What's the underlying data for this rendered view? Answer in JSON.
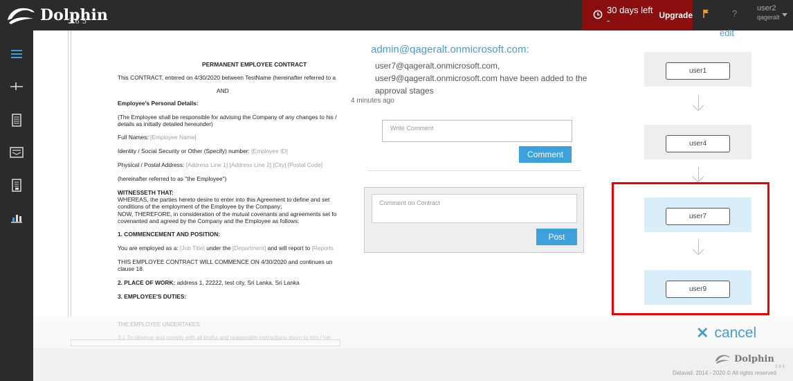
{
  "header": {
    "brand": "Dolphin",
    "brand_sub": "365",
    "trial_text": "30 days left -",
    "upgrade_label": "Upgrade",
    "help_label": "?",
    "user_name": "user2",
    "user_org": "qageralt"
  },
  "sidebar": {
    "items": [
      {
        "icon": "menu-icon"
      },
      {
        "icon": "signature-icon"
      },
      {
        "icon": "documents-icon"
      },
      {
        "icon": "inbox-icon"
      },
      {
        "icon": "contract-icon"
      },
      {
        "icon": "reports-icon"
      }
    ]
  },
  "document": {
    "title": "PERMANENT EMPLOYEE CONTRACT",
    "line1": "This CONTRACT, entered on 4/30/2020 between TestName (hereinafter referred to a",
    "and": "AND",
    "personal_heading": "Employee's Personal Details:",
    "personal_text1": "(The Employee shall be responsible for advising the Company of any changes to his /",
    "personal_text2": "details as initially detailed hereunder)",
    "full_names_label": "Full Names:",
    "full_names_value": "[Employee Name]",
    "id_label": "Identity / Social Security or Other (Specify) number:",
    "id_value": "[Employee ID]",
    "address_label": "Physical / Postal Address:",
    "address_value": "[Address Line 1] [Address Line 2] [City] [Postal Code]",
    "employee_ref": "(hereinafter referred to as \"the Employee\")",
    "witness_heading": "WITNESSETH THAT:",
    "whereas1": "WHEREAS, the parties hereto desire to enter into this Agreement to define and set",
    "whereas2": "conditions of the employment of the Employee by the Company;",
    "now1": "NOW, THEREFORE, in consideration of the mutual covenants and agreements set fo",
    "now2": "covenanted and agreed by the Company and the Employee as follows:",
    "section1": "1. COMMENCEMENT AND POSITION:",
    "employed_pre": "You are employed as a:",
    "employed_title": "[Job Title]",
    "employed_mid": "under the",
    "employed_dept": "[Department]",
    "employed_post": "and will report to",
    "employed_reports": "[Reports",
    "commence1": "THIS EMPLOYEE CONTRACT WILL COMMENCE ON 4/30/2020 and continues un",
    "commence2": "clause 18.",
    "section2_label": "2. PLACE OF WORK:",
    "section2_value": "address 1, 22222, test city, Sri Lanka, Sri Lanka",
    "section3": "3. EMPLOYEE'S DUTIES:",
    "undertakes": "THE EMPLOYEE UNDERTAKES:",
    "faded_line": "3.1 To observe and comply with all lawful and reasonable instructions given to him / her"
  },
  "activity": {
    "author": "admin@qageralt.onmicrosoft.com:",
    "message": "user7@qageralt.onmicrosoft.com, user9@qageralt.onmicrosoft.com have been added to the approval stages",
    "time": "4 minutes ago",
    "comment_placeholder": "Write Comment",
    "comment_button": "Comment",
    "post_placeholder": "Comment on Contract",
    "post_button": "Post"
  },
  "approval": {
    "edit_label": "edit",
    "stages": [
      {
        "user": "user1",
        "bg": "#eeeeee"
      },
      {
        "user": "user4",
        "bg": "#eeeeee"
      },
      {
        "user": "user7",
        "bg": "#d9eefb"
      },
      {
        "user": "user9",
        "bg": "#d9eefb"
      }
    ],
    "highlight_color": "#e00000"
  },
  "footer": {
    "cancel_label": "cancel",
    "brand": "Dolphin",
    "brand_sub": "365",
    "copyright": "Datavail. 2014 - 2020 © All rights reserved"
  },
  "colors": {
    "accent": "#3ca1dc",
    "link": "#4b9cd3",
    "trial_bg": "#8b0e0e",
    "topbar": "#2b2b2b"
  }
}
